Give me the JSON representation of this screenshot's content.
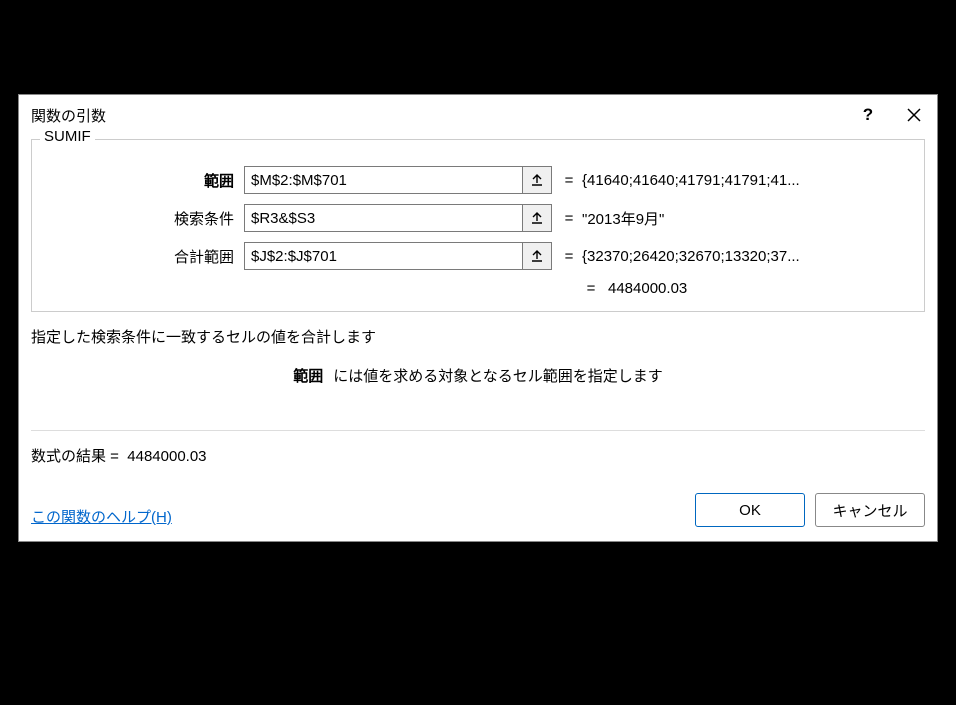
{
  "dialog": {
    "title": "関数の引数",
    "function_name": "SUMIF",
    "args": [
      {
        "label": "範囲",
        "bold": true,
        "value": "$M$2:$M$701",
        "result": "{41640;41640;41791;41791;41..."
      },
      {
        "label": "検索条件",
        "bold": false,
        "value": "$R3&$S3",
        "result": "\"2013年9月\""
      },
      {
        "label": "合計範囲",
        "bold": false,
        "value": "$J$2:$J$701",
        "result": "{32370;26420;32670;13320;37..."
      }
    ],
    "calc_result": "4484000.03",
    "description1": "指定した検索条件に一致するセルの値を合計します",
    "description2_label": "範囲",
    "description2_text": "には値を求める対象となるセル範囲を指定します",
    "formula_result_label": "数式の結果 =",
    "formula_result_value": "4484000.03",
    "help_link": "この関数のヘルプ(H)",
    "ok_label": "OK",
    "cancel_label": "キャンセル"
  }
}
